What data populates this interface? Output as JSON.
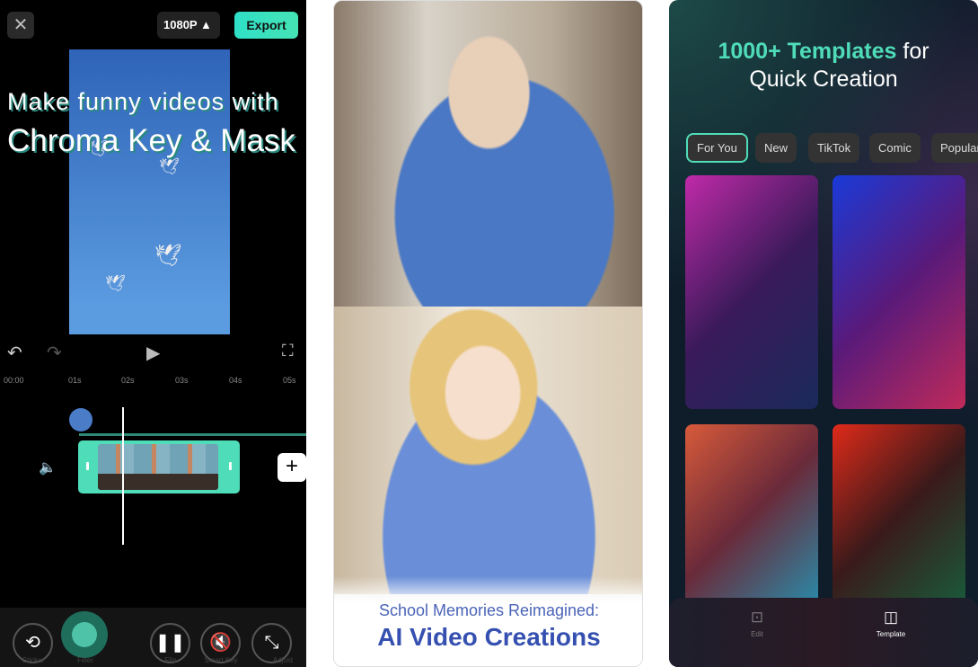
{
  "editor": {
    "close_icon": "close-icon",
    "resolution": "1080P",
    "export_label": "Export",
    "headline_line1": "Make funny videos with",
    "headline_line2": "Chroma Key & Mask",
    "timeline_ticks": [
      "00:00",
      "01s",
      "02s",
      "03s",
      "04s",
      "05s"
    ],
    "toolbar": [
      {
        "label": "Sticker",
        "icon": "rotate-icon"
      },
      {
        "label": "Filter",
        "icon": "filter-icon"
      },
      {
        "label": "Flip",
        "icon": "pause-icon"
      },
      {
        "label": "Smart Key",
        "icon": "mute-icon"
      },
      {
        "label": "Adjust",
        "icon": "resize-icon"
      }
    ],
    "accent": "#4fdcb8"
  },
  "ai_promo": {
    "subtitle": "School Memories Reimagined:",
    "title": "AI Video Creations",
    "text_color": "#3550b0"
  },
  "templates": {
    "title_highlight": "1000+ Templates",
    "title_rest": " for",
    "title_line2": "Quick Creation",
    "chips": [
      "For You",
      "New",
      "TikTok",
      "Comic",
      "Popular"
    ],
    "selected_chip": "For You",
    "nav": [
      {
        "label": "Edit",
        "icon": "edit-icon"
      },
      {
        "label": "Template",
        "icon": "template-icon"
      }
    ],
    "selected_nav": "Template"
  }
}
